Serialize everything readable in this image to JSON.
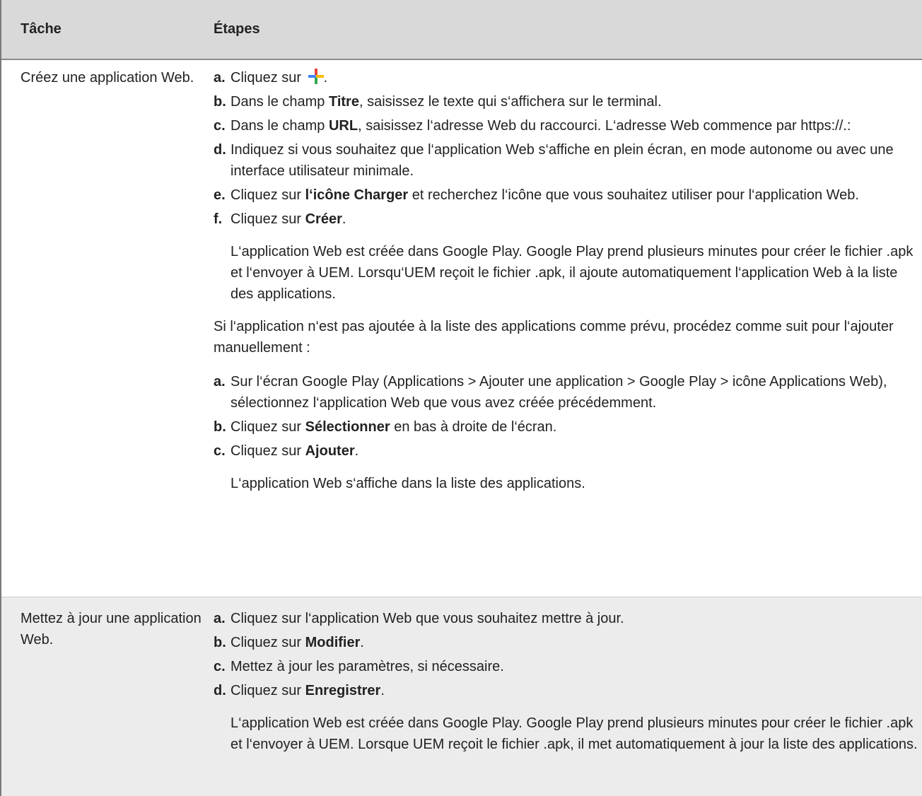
{
  "table": {
    "header": {
      "task": "Tâche",
      "steps": "Étapes"
    },
    "row1": {
      "task": "Créez une application Web.",
      "steps": [
        {
          "marker": "a.",
          "pre": "Cliquez sur ",
          "bold": "",
          "post": "."
        },
        {
          "marker": "b.",
          "pre": "Dans le champ ",
          "bold": "Titre",
          "post": ", saisissez le texte qui s‘affichera sur le terminal."
        },
        {
          "marker": "c.",
          "pre": "Dans le champ ",
          "bold": "URL",
          "post": ", saisissez l‘adresse Web du raccourci. L‘adresse Web commence par https://.:"
        },
        {
          "marker": "d.",
          "pre": "Indiquez si vous souhaitez que l‘application Web s‘affiche en plein écran, en mode autonome ou avec une interface utilisateur minimale.",
          "bold": "",
          "post": ""
        },
        {
          "marker": "e.",
          "pre": "Cliquez sur ",
          "bold": "l‘icône Charger",
          "post": " et recherchez l‘icône que vous souhaitez utiliser pour l‘application Web."
        },
        {
          "marker": "f.",
          "pre": "Cliquez sur ",
          "bold": "Créer",
          "post": "."
        }
      ],
      "result": "L‘application Web est créée dans Google Play. Google Play prend plusieurs minutes pour créer le fichier .apk et l‘envoyer à UEM. Lorsqu‘UEM reçoit le fichier .apk, il ajoute automatiquement l‘application Web à la liste des applications.",
      "fallback": "Si l‘application n‘est pas ajoutée à la liste des applications comme prévu, procédez comme suit pour l‘ajouter manuellement :",
      "steps2": [
        {
          "marker": "a.",
          "pre": "Sur l‘écran Google Play (Applications > Ajouter une application > Google Play > icône Applications Web), sélectionnez l‘application Web que vous avez créée précédemment.",
          "bold": "",
          "post": ""
        },
        {
          "marker": "b.",
          "pre": "Cliquez sur ",
          "bold": "Sélectionner",
          "post": " en bas à droite de l‘écran."
        },
        {
          "marker": "c.",
          "pre": "Cliquez sur ",
          "bold": "Ajouter",
          "post": "."
        }
      ],
      "result2": "L‘application Web s‘affiche dans la liste des applications."
    },
    "row2": {
      "task": "Mettez à jour une application Web.",
      "steps": [
        {
          "marker": "a.",
          "pre": "Cliquez sur l‘application Web que vous souhaitez mettre à jour.",
          "bold": "",
          "post": ""
        },
        {
          "marker": "b.",
          "pre": "Cliquez sur ",
          "bold": "Modifier",
          "post": "."
        },
        {
          "marker": "c.",
          "pre": "Mettez à jour les paramètres, si nécessaire.",
          "bold": "",
          "post": ""
        },
        {
          "marker": "d.",
          "pre": "Cliquez sur ",
          "bold": "Enregistrer",
          "post": "."
        }
      ],
      "result": "L‘application Web est créée dans Google Play. Google Play prend plusieurs minutes pour créer le fichier .apk et l‘envoyer à UEM. Lorsque UEM reçoit le fichier .apk, il met automatiquement à jour la liste des applications."
    }
  },
  "icons": {
    "add": "plus-icon",
    "colors": [
      "#e84335",
      "#4285f4",
      "#fbbc05",
      "#34a853"
    ]
  }
}
